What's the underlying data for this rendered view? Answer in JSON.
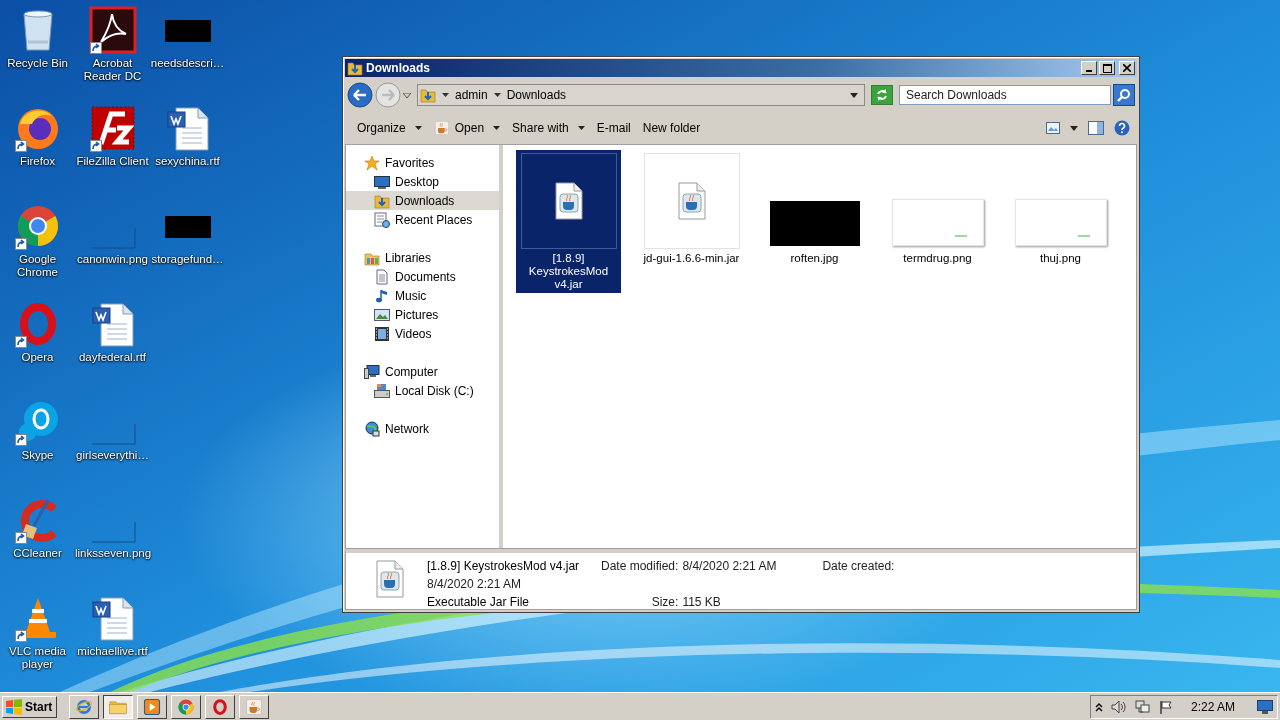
{
  "desktop": {
    "icons": [
      {
        "label": "Recycle Bin",
        "kind": "recycle-bin",
        "shortcut": false
      },
      {
        "label": "Firefox",
        "kind": "firefox",
        "shortcut": true
      },
      {
        "label": "Google Chrome",
        "kind": "chrome",
        "shortcut": true
      },
      {
        "label": "Opera",
        "kind": "opera",
        "shortcut": true
      },
      {
        "label": "Skype",
        "kind": "skype",
        "shortcut": true
      },
      {
        "label": "CCleaner",
        "kind": "ccleaner",
        "shortcut": true
      },
      {
        "label": "VLC media player",
        "kind": "vlc",
        "shortcut": true
      },
      {
        "label": "Acrobat Reader DC",
        "kind": "acrobat",
        "shortcut": true
      },
      {
        "label": "FileZilla Client",
        "kind": "filezilla",
        "shortcut": true
      },
      {
        "label": "canonwin.png",
        "kind": "image-blank",
        "shortcut": false
      },
      {
        "label": "dayfederal.rtf",
        "kind": "word-document",
        "shortcut": false
      },
      {
        "label": "girlseverythi…",
        "kind": "image-blank",
        "shortcut": false
      },
      {
        "label": "linksseven.png",
        "kind": "image-blank",
        "shortcut": false
      },
      {
        "label": "michaellive.rtf",
        "kind": "word-document",
        "shortcut": false
      },
      {
        "label": "needsdescri…",
        "kind": "image-black",
        "shortcut": false
      },
      {
        "label": "sexychina.rtf",
        "kind": "word-document",
        "shortcut": false
      },
      {
        "label": "storagefund…",
        "kind": "image-black",
        "shortcut": false
      }
    ]
  },
  "window": {
    "title": "Downloads",
    "address": {
      "segments": [
        "admin",
        "Downloads"
      ]
    },
    "search": {
      "placeholder": "Search Downloads"
    },
    "commands": [
      {
        "label": "Organize",
        "kind": "plain",
        "dropdown": true
      },
      {
        "label": "Open",
        "kind": "with-icon",
        "dropdown": true
      },
      {
        "label": "Share with",
        "kind": "plain",
        "dropdown": true
      },
      {
        "label": "E-mail",
        "kind": "plain",
        "dropdown": false
      },
      {
        "label": "New folder",
        "kind": "plain",
        "dropdown": false
      }
    ],
    "navigation": [
      {
        "label": "Favorites",
        "kind": "favorites",
        "selected": false,
        "children": [
          {
            "label": "Desktop",
            "kind": "desktop",
            "selected": false
          },
          {
            "label": "Downloads",
            "kind": "downloads",
            "selected": true
          },
          {
            "label": "Recent Places",
            "kind": "recent",
            "selected": false
          }
        ]
      },
      {
        "label": "Libraries",
        "kind": "libraries",
        "selected": false,
        "children": [
          {
            "label": "Documents",
            "kind": "documents",
            "selected": false
          },
          {
            "label": "Music",
            "kind": "music",
            "selected": false
          },
          {
            "label": "Pictures",
            "kind": "pictures",
            "selected": false
          },
          {
            "label": "Videos",
            "kind": "videos",
            "selected": false
          }
        ]
      },
      {
        "label": "Computer",
        "kind": "computer",
        "selected": false,
        "children": [
          {
            "label": "Local Disk (C:)",
            "kind": "disk",
            "selected": false
          }
        ]
      },
      {
        "label": "Network",
        "kind": "network",
        "selected": false
      }
    ],
    "files": [
      {
        "name": "[1.8.9] KeystrokesMod v4.jar",
        "kind": "jar",
        "selected": true
      },
      {
        "name": "jd-gui-1.6.6-min.jar",
        "kind": "jar",
        "selected": false
      },
      {
        "name": "roften.jpg",
        "kind": "image-black",
        "selected": false
      },
      {
        "name": "termdrug.png",
        "kind": "image-white",
        "selected": false
      },
      {
        "name": "thuj.png",
        "kind": "image-white",
        "selected": false
      }
    ],
    "details": {
      "name": "[1.8.9] KeystrokesMod v4.jar",
      "type": "Executable Jar File",
      "fields": [
        {
          "label": "Date modified:",
          "value": "8/4/2020 2:21 AM"
        },
        {
          "label": "Date created:",
          "value": "8/4/2020 2:21 AM"
        },
        {
          "label": "Size:",
          "value": "115 KB"
        }
      ]
    }
  },
  "taskbar": {
    "start": "Start",
    "apps": [
      {
        "kind": "internet-explorer",
        "active": false
      },
      {
        "kind": "explorer",
        "active": true
      },
      {
        "kind": "media-player",
        "active": false
      },
      {
        "kind": "chrome",
        "active": false
      },
      {
        "kind": "opera",
        "active": false
      },
      {
        "kind": "java",
        "active": false
      }
    ],
    "clock": "2:22 AM"
  }
}
